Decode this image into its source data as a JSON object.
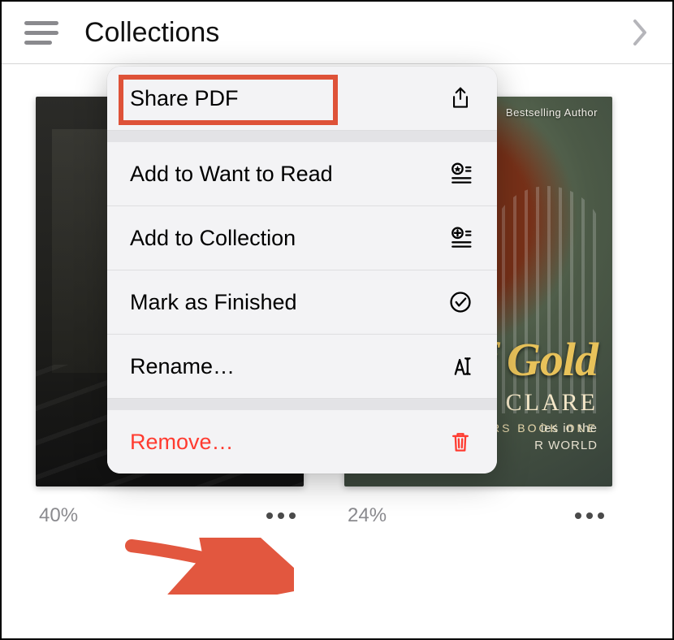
{
  "header": {
    "title": "Collections"
  },
  "menu": {
    "items": [
      {
        "label": "Share PDF",
        "icon": "share-icon",
        "destructive": false
      },
      {
        "label": "Add to Want to Read",
        "icon": "star-list-icon",
        "destructive": false
      },
      {
        "label": "Add to Collection",
        "icon": "plus-list-icon",
        "destructive": false
      },
      {
        "label": "Mark as Finished",
        "icon": "checkmark-circle-icon",
        "destructive": false
      },
      {
        "label": "Rename…",
        "icon": "text-cursor-icon",
        "destructive": false
      },
      {
        "label": "Remove…",
        "icon": "trash-icon",
        "destructive": true
      }
    ]
  },
  "books": [
    {
      "progress": "40%"
    },
    {
      "progress": "24%"
    }
  ],
  "cover2": {
    "topbadge": "Bestselling Author",
    "title_fragment": "f Gold",
    "author_fragment": "A CLARE",
    "series_fragment": "OURS   BOOK ONE",
    "tagline_line1": "ies in the",
    "tagline_line2": "R WORLD"
  },
  "annotations": {
    "highlight_color": "#de5238",
    "arrow_color": "#e2573f"
  }
}
